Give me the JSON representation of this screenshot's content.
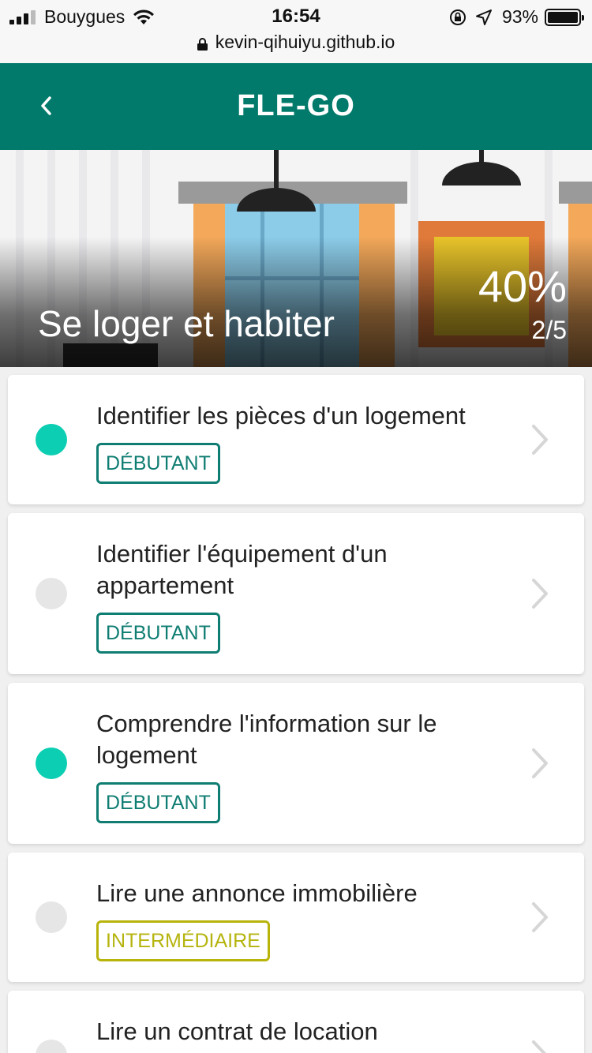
{
  "status_bar": {
    "carrier": "Bouygues",
    "time": "16:54",
    "battery": "93%",
    "url": "kevin-qihuiyu.github.io"
  },
  "header": {
    "title": "FLE-GO",
    "back_icon": "chevron-left-icon"
  },
  "hero": {
    "title": "Se loger et habiter",
    "percent": "40%",
    "count": "2/5"
  },
  "lessons": [
    {
      "title": "Identifier les pièces d'un logement",
      "level": "DÉBUTANT",
      "completed": true
    },
    {
      "title": "Identifier l'équipement d'un appartement",
      "level": "DÉBUTANT",
      "completed": false
    },
    {
      "title": "Comprendre l'information sur le logement",
      "level": "DÉBUTANT",
      "completed": true
    },
    {
      "title": "Lire une annonce immobilière",
      "level": "INTERMÉDIAIRE",
      "completed": false
    },
    {
      "title": "Lire un contrat de location",
      "level": "",
      "completed": false
    }
  ],
  "colors": {
    "brand": "#017a6b",
    "completed": "#0cceb3",
    "beginner": "#0f7d72",
    "intermediate": "#b5b40f"
  }
}
